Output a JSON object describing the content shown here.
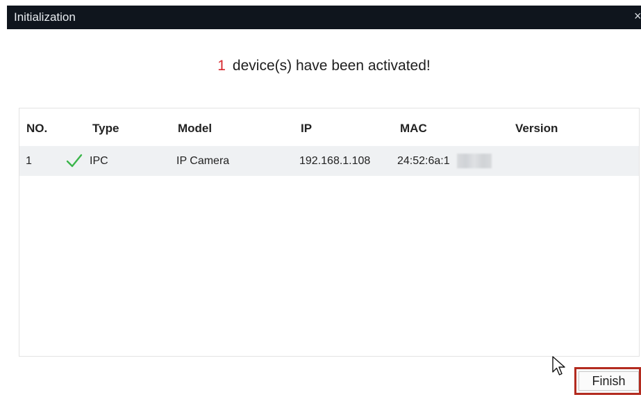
{
  "window": {
    "title": "Initialization",
    "close_glyph": "×"
  },
  "message": {
    "count": "1",
    "text": "device(s) have been activated!"
  },
  "table": {
    "headers": [
      "NO.",
      "Type",
      "Model",
      "IP",
      "MAC",
      "Version"
    ],
    "rows": [
      {
        "no": "1",
        "status_icon": "check-icon",
        "type": "IPC",
        "model": "IP Camera",
        "ip": "192.168.1.108",
        "mac": "24:52:6a:1",
        "version": ""
      }
    ]
  },
  "buttons": {
    "finish_label": "Finish"
  },
  "colors": {
    "titlebar_bg": "#0f151d",
    "count_red": "#d6262c",
    "check_green": "#3ab54a",
    "highlight_red": "#b32b1f"
  }
}
